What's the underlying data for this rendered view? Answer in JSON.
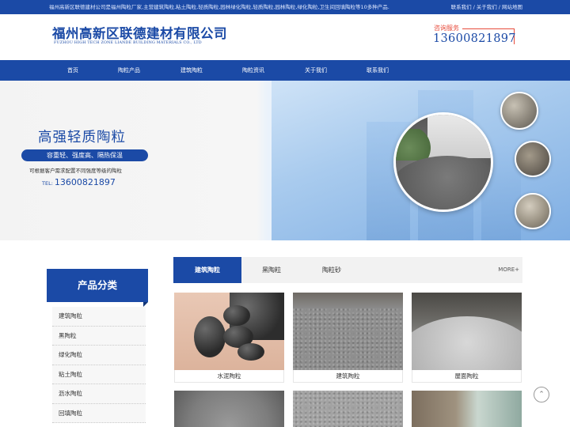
{
  "topbar": {
    "intro": "福州高新区联德建材公司是福州陶粒厂家,主营建筑陶粒,粘土陶粒,轻质陶粒,园林绿化陶粒,轻质陶粒,园林陶粒,绿化陶粒,卫生间回填陶粒等10多种产品.",
    "links": [
      "联系我们",
      "/",
      "关于我们",
      "/",
      "网站地图"
    ]
  },
  "header": {
    "logo_cn": "福州高新区联德建材有限公司",
    "logo_en": "FUZHOU HIGH TECH ZONE LIANDE BUILDING MATERIALS CO., LTD",
    "hotline_label": "咨询服务",
    "hotline_phone": "13600821897"
  },
  "nav": {
    "items": [
      "首页",
      "陶粒产品",
      "建筑陶粒",
      "陶粒资讯",
      "关于我们",
      "联系我们"
    ]
  },
  "banner": {
    "title": "高强轻质陶粒",
    "pill": "容重轻、强度高、隔热保温",
    "sub": "可根据客户需求配置不同强度等级的陶粒",
    "tel_label": "TEL:",
    "tel": "13600821897"
  },
  "sidebar": {
    "title": "产品分类",
    "items": [
      "建筑陶粒",
      "黑陶粒",
      "绿化陶粒",
      "粘土陶粒",
      "沥水陶粒",
      "回填陶粒"
    ]
  },
  "tabs": {
    "items": [
      "建筑陶粒",
      "黑陶粒",
      "陶粒砂"
    ],
    "active": 0,
    "more": "MORE+"
  },
  "products": [
    {
      "caption": "水泥陶粒"
    },
    {
      "caption": "建筑陶粒"
    },
    {
      "caption": "屋面陶粒"
    }
  ],
  "icons": {
    "gotop": "chevron-up-icon"
  },
  "colors": {
    "brand": "#1b4aa6",
    "accent": "#e74c3c"
  }
}
